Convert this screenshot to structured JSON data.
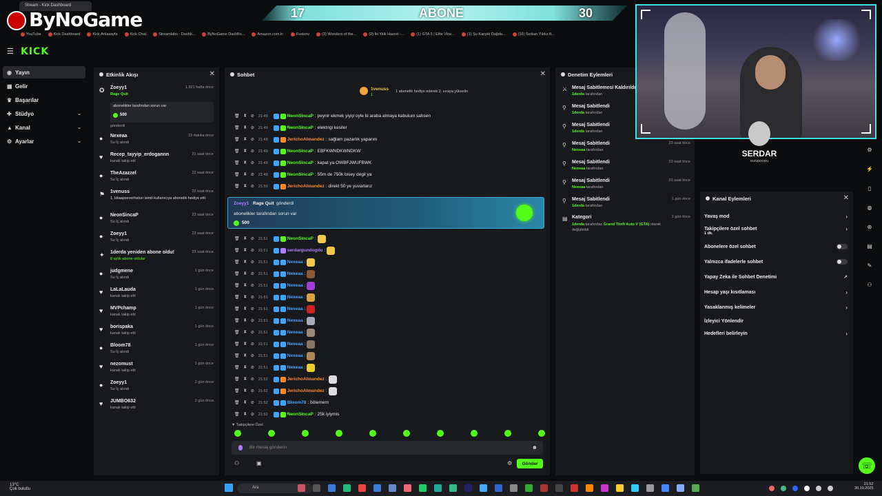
{
  "browser": {
    "tab_title": "Stream - Kick Dashboard",
    "bookmarks": [
      "YouTube",
      "Kick Dashboard",
      "Kick Arılasayfa",
      "Kick Chat",
      "Streamlabs - Dashb...",
      "ByNoGame DashBo...",
      "Amazon.com.tr:",
      "Fusionv",
      "(3) Wonders of the...",
      "(2) İki Yitik Hasret -...",
      "(1) GTA 5 | Elite Vine...",
      "(1) Şu Karşıki Dağda...",
      "(16) Serkan Yıldız ft..."
    ]
  },
  "overlay": {
    "brand": "ByNoGame",
    "sub_left": "17",
    "sub_label": "ABONE",
    "sub_right": "30",
    "streamer_logo": "SERDAR",
    "streamer_sub": "GUNDOGDU"
  },
  "nav": {
    "logo": "KICK",
    "items": [
      {
        "label": "Yayın",
        "icon": "broadcast-icon"
      },
      {
        "label": "Gelir",
        "icon": "wallet-icon"
      },
      {
        "label": "Başarılar",
        "icon": "trophy-icon"
      },
      {
        "label": "Stüdyo",
        "icon": "studio-icon"
      },
      {
        "label": "Kanal",
        "icon": "channel-icon"
      },
      {
        "label": "Ayarlar",
        "icon": "settings-icon"
      }
    ]
  },
  "activity": {
    "title": "Etkinlik Akışı",
    "gift_quote": "abonelikler tarafından sorun var",
    "gift_amount": "500",
    "gift_sent": "gönderdi",
    "items": [
      {
        "name": "Zoeyy1",
        "sub": "Rage Quit",
        "time": "1.921 hafta önce",
        "icon": "gift-icon"
      },
      {
        "name": "Nexeaa",
        "sub": "Su İç alındı",
        "time": "23 dakika önce",
        "icon": "drink-icon"
      },
      {
        "name": "Recep_tayyip_erdogannn",
        "sub": "kanalı takip etti",
        "time": "21 saat önce",
        "icon": "heart-icon"
      },
      {
        "name": "TheAzazzel",
        "sub": "Su İç alındı",
        "time": "22 saat önce",
        "icon": "drink-icon"
      },
      {
        "name": "1venuss",
        "sub": "1, kitaapseverhatun isimli kullanıcıya abonelik hediye etti.",
        "time": "22 saat önce",
        "icon": "gift-sub-icon"
      },
      {
        "name": "NeonSincaP",
        "sub": "Su İç alındı",
        "time": "23 saat önce",
        "icon": "drink-icon"
      },
      {
        "name": "Zoeyy1",
        "sub": "Su İç alındı",
        "time": "23 saat önce",
        "icon": "drink-icon"
      },
      {
        "name": "1derda yeniden abone oldu!",
        "sub": "8 aylık abone oldular",
        "time": "23 saat önce",
        "icon": "star-icon"
      },
      {
        "name": "judgmene",
        "sub": "Su İç alındı",
        "time": "1 gün önce",
        "icon": "drink-icon"
      },
      {
        "name": "LaLaLauda",
        "sub": "kanalı takip etti",
        "time": "1 gün önce",
        "icon": "heart-icon"
      },
      {
        "name": "MVPchamp",
        "sub": "kanalı takip etti",
        "time": "1 gün önce",
        "icon": "heart-icon"
      },
      {
        "name": "borispaka",
        "sub": "kanalı takip etti",
        "time": "1 gün önce",
        "icon": "heart-icon"
      },
      {
        "name": "Bloom78",
        "sub": "Su İç alındı",
        "time": "1 gün önce",
        "icon": "drink-icon"
      },
      {
        "name": "nezomust",
        "sub": "kanalı takip etti",
        "time": "1 gün önce",
        "icon": "heart-icon"
      },
      {
        "name": "Zoeyy1",
        "sub": "Su İç alındı",
        "time": "2 gün önce",
        "icon": "drink-icon"
      },
      {
        "name": "JUMBO632",
        "sub": "kanalı takip etti",
        "time": "2 gün önce",
        "icon": "heart-icon"
      }
    ]
  },
  "chat": {
    "title": "Sohbet",
    "pinned_user": "1venuss",
    "pinned_count": "1",
    "pinned_text": "1 abonelik hediye ederek 2. sıraya yükselin",
    "gift_card_user": "Zoeyy1",
    "gift_card_label": "Rage Quit",
    "gift_card_sent": "gönderdi",
    "gift_card_msg": "abonelikler tarafından sorun var",
    "gift_card_amount": "500",
    "messages": [
      {
        "time": "21:49",
        "user": "NeonSincaP",
        "color": "#53fc18",
        "text": "peynir ekmek yiyip oyle bi araba almaya kabulum sahsen",
        "emote": ""
      },
      {
        "time": "21:49",
        "user": "NeonSincaP",
        "color": "#53fc18",
        "text": "elektrigi kesiler",
        "emote": ""
      },
      {
        "time": "21:49",
        "user": "JerichoAlmandez",
        "color": "#ff8a24",
        "text": "sağlam pazarlık yaparım",
        "emote": ""
      },
      {
        "time": "21:49",
        "user": "NeonSincaP",
        "color": "#53fc18",
        "text": "EBFKWNDKWNDKW",
        "emote": ""
      },
      {
        "time": "21:49",
        "user": "NeonSincaP",
        "color": "#53fc18",
        "text": "kapat ya OWBFJWUFBWK",
        "emote": ""
      },
      {
        "time": "21:49",
        "user": "NeonSincaP",
        "color": "#53fc18",
        "text": "55m de 750k bisey degil ya",
        "emote": ""
      },
      {
        "time": "21:50",
        "user": "JerichoAlmandez",
        "color": "#ff8a24",
        "text": "direkt 50 ye yuvarlarız",
        "emote": ""
      }
    ],
    "messages2": [
      {
        "time": "21:51",
        "user": "NeonSincaP",
        "color": "#53fc18",
        "text": "",
        "emote": "#f2c94c"
      },
      {
        "time": "21:51",
        "user": "serdargundogdu",
        "color": "#b07cff",
        "text": "",
        "emote": "#f2c94c"
      },
      {
        "time": "21:51",
        "user": "Nexeaa",
        "color": "#3ea6ff",
        "text": "",
        "emote": "#f2c94c"
      },
      {
        "time": "21:51",
        "user": "Nexeaa",
        "color": "#3ea6ff",
        "text": "",
        "emote": "#8a5a3a"
      },
      {
        "time": "21:51",
        "user": "Nexeaa",
        "color": "#3ea6ff",
        "text": "",
        "emote": "#a23fd8"
      },
      {
        "time": "21:51",
        "user": "Nexeaa",
        "color": "#3ea6ff",
        "text": "",
        "emote": "#d8a23f"
      },
      {
        "time": "21:51",
        "user": "Nexeaa",
        "color": "#3ea6ff",
        "text": "",
        "emote": "#c22"
      },
      {
        "time": "21:51",
        "user": "Nexeaa",
        "color": "#3ea6ff",
        "text": "",
        "emote": "#aab"
      },
      {
        "time": "21:51",
        "user": "Nexeaa",
        "color": "#3ea6ff",
        "text": "",
        "emote": "#987"
      },
      {
        "time": "21:51",
        "user": "Nexeaa",
        "color": "#3ea6ff",
        "text": "",
        "emote": "#876"
      },
      {
        "time": "21:51",
        "user": "Nexeaa",
        "color": "#3ea6ff",
        "text": "",
        "emote": "#a85"
      },
      {
        "time": "21:51",
        "user": "Nexeaa",
        "color": "#3ea6ff",
        "text": "",
        "emote": "#ec3"
      },
      {
        "time": "21:52",
        "user": "JerichoAlmandez",
        "color": "#ff8a24",
        "text": "",
        "emote": "#ddd"
      },
      {
        "time": "21:52",
        "user": "JerichoAlmandez",
        "color": "#ff8a24",
        "text": "",
        "emote": "#ddd"
      },
      {
        "time": "21:52",
        "user": "Bloom78",
        "color": "#3ea6ff",
        "text": "bölemem",
        "emote": ""
      },
      {
        "time": "21:52",
        "user": "NeonSincaP",
        "color": "#53fc18",
        "text": "25k iyiymis",
        "emote": ""
      }
    ],
    "followers_only": "Takipçilere Özel",
    "input_placeholder": "Bir mesaj gönderin",
    "send_label": "Gönder"
  },
  "moderation": {
    "title": "Denetim Eylemleri",
    "items": [
      {
        "title": "Mesaj Sabitlemesi Kaldırıldı",
        "by": "1derda",
        "suffix": "tarafından",
        "time": "",
        "icon": "unpin-icon"
      },
      {
        "title": "Mesaj Sabitlendi",
        "by": "1derda",
        "suffix": "tarafından",
        "time": "",
        "icon": "pin-icon"
      },
      {
        "title": "Mesaj Sabitlendi",
        "by": "1derda",
        "suffix": "tarafından",
        "time": "",
        "icon": "pin-icon"
      },
      {
        "title": "Mesaj Sabitlendi",
        "by": "Nexeaa",
        "suffix": "tarafından",
        "time": "23 saat önce",
        "icon": "pin-icon"
      },
      {
        "title": "Mesaj Sabitlendi",
        "by": "Nexeaa",
        "suffix": "tarafından",
        "time": "23 saat önce",
        "icon": "pin-icon"
      },
      {
        "title": "Mesaj Sabitlendi",
        "by": "Nexeaa",
        "suffix": "tarafından",
        "time": "23 saat önce",
        "icon": "pin-icon"
      },
      {
        "title": "Mesaj Sabitlendi",
        "by": "1derda",
        "suffix": "tarafından",
        "time": "1 gün önce",
        "icon": "pin-icon"
      }
    ],
    "category_title": "Kategori",
    "category_by": "1derda",
    "category_mid": "tarafından",
    "category_game": "Grand Theft Auto V (GTA)",
    "category_tail": "olarak değiştirildi",
    "category_time": "1 gün önce"
  },
  "channel_actions": {
    "title": "Kanal Eylemleri",
    "items": [
      {
        "label": "Yavaş mod",
        "sub": "",
        "control": "chevron"
      },
      {
        "label": "Takipçilere özel sohbet",
        "sub": "1 dk.",
        "control": "chevron"
      },
      {
        "label": "Abonelere özel sohbet",
        "sub": "",
        "control": "toggle"
      },
      {
        "label": "Yalnızca ifadelerle sohbet",
        "sub": "",
        "control": "toggle"
      },
      {
        "label": "Yapay Zeka ile Sohbet Denetimi",
        "sub": "",
        "control": "external"
      },
      {
        "label": "Hesap yaşı kısıtlaması",
        "sub": "",
        "control": "chevron"
      },
      {
        "label": "Yasaklanmış kelimeler",
        "sub": "",
        "control": "chevron"
      },
      {
        "label": "İzleyici Yönlendir",
        "sub": "",
        "control": ""
      },
      {
        "label": "Hedefleri belirleyin",
        "sub": "",
        "control": "chevron"
      }
    ]
  },
  "taskbar": {
    "temp": "13°C",
    "weather": "Çok bulutlu",
    "search": "Ara",
    "time": "21:52",
    "date": "30.10.2025"
  },
  "colors": {
    "kick_green": "#53fc18",
    "cyan": "#3ee2e6",
    "panel": "#18191c"
  }
}
